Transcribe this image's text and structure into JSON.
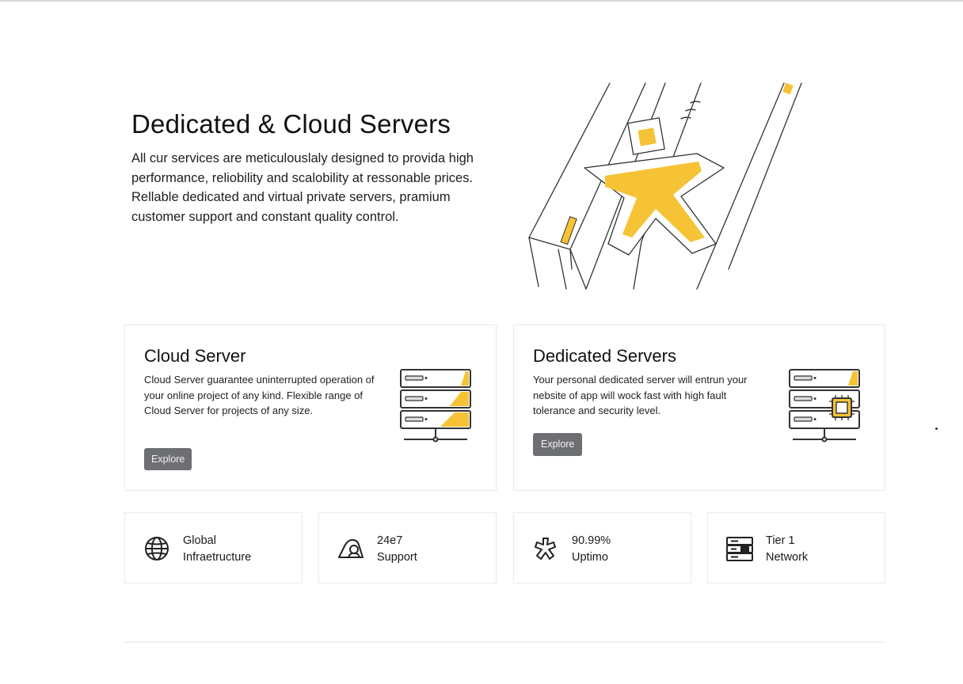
{
  "colors": {
    "accent": "#f5c335",
    "line": "#333333",
    "button": "#6d6f73",
    "border": "#ececec"
  },
  "hero": {
    "title": "Dedicated & Cloud Servers",
    "description": "All cur services are meticulouslaly designed to provida high performance, reliobility and scalobility at ressonable prices. Rellable dedicated and virtual private servers, pramium customer support and constant quality control.",
    "illustration_icon": "server-rack-star-illustration"
  },
  "cards": [
    {
      "title": "Cloud Server",
      "description": "Cloud Server guarantee uninterrupted operation of your online project of any kind. Flexible range of Cloud Server for projects of any size.",
      "button_label": "Explore",
      "icon": "server-stack-icon"
    },
    {
      "title": "Dedicated Servers",
      "description": "Your personal dedicated server will entrun your nebsite of app will wock fast with high fault tolerance and security level.",
      "button_label": "Explore",
      "icon": "server-chip-icon"
    }
  ],
  "features": [
    {
      "line1": "Global",
      "line2": "Infraetructure",
      "icon": "globe-icon"
    },
    {
      "line1": "24e7",
      "line2": "Support",
      "icon": "support-icon"
    },
    {
      "line1": "90.99%",
      "line2": "Uptimo",
      "icon": "uptime-star-icon"
    },
    {
      "line1": "Tier 1",
      "line2": "Network",
      "icon": "network-icon"
    }
  ]
}
